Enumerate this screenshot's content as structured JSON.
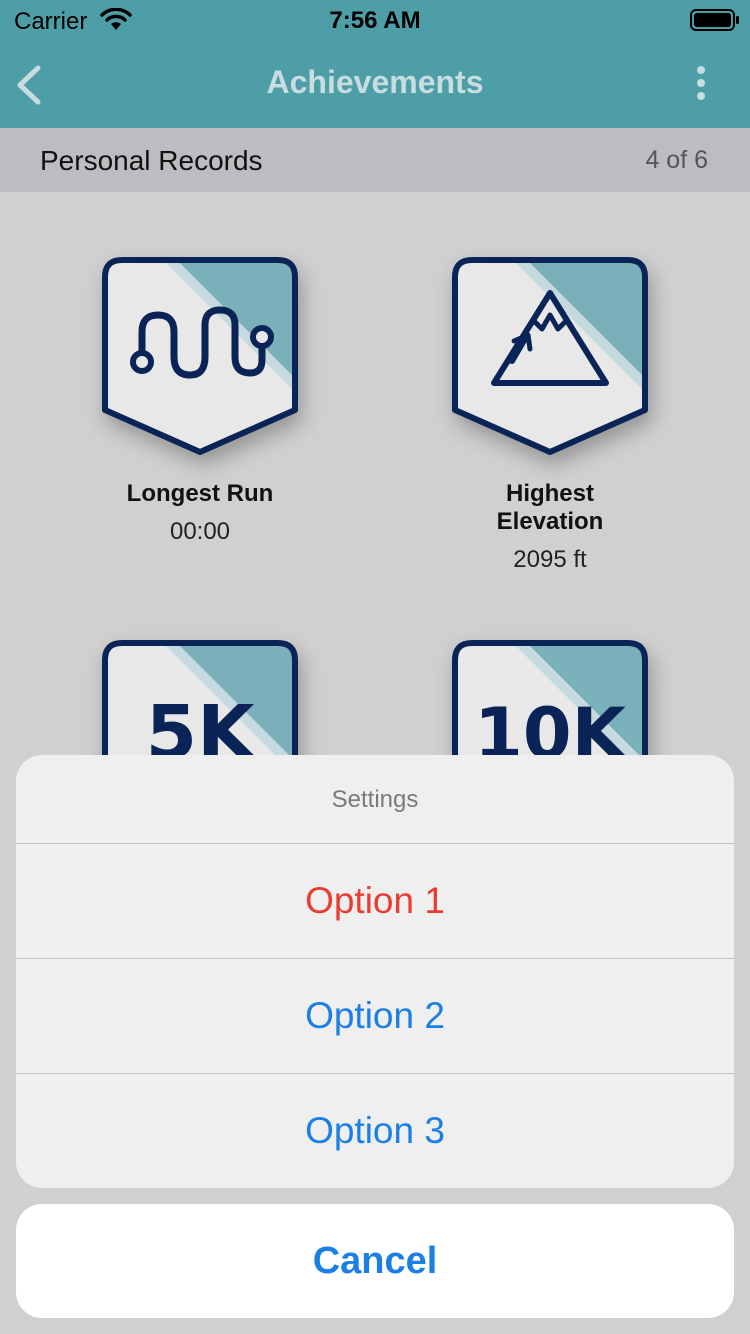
{
  "status_bar": {
    "carrier": "Carrier",
    "time": "7:56 AM"
  },
  "nav": {
    "title": "Achievements",
    "back_icon": "chevron-left-icon",
    "more_icon": "vertical-ellipsis-icon"
  },
  "section": {
    "title": "Personal Records",
    "count": "4 of 6"
  },
  "badges": [
    {
      "label": "Longest Run",
      "value": "00:00",
      "icon": "route-squiggle-icon"
    },
    {
      "label": "Highest Elevation",
      "value": "2095 ft",
      "icon": "mountain-icon"
    },
    {
      "text": "5K"
    },
    {
      "text": "10K"
    }
  ],
  "action_sheet": {
    "title": "Settings",
    "options": [
      "Option 1",
      "Option 2",
      "Option 3"
    ],
    "cancel": "Cancel"
  },
  "colors": {
    "header_teal": "#4e9ea7",
    "badge_fill": "#7ab0ba",
    "badge_stroke": "#0b2457",
    "ios_blue": "#1c7fe6",
    "destructive_red": "#ea3d30"
  }
}
